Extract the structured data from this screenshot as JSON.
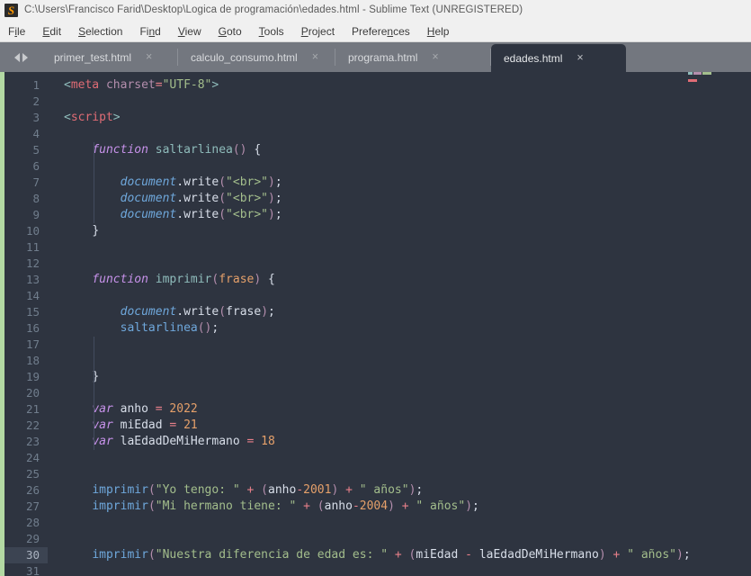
{
  "window": {
    "title": "C:\\Users\\Francisco Farid\\Desktop\\Logica de programación\\edades.html - Sublime Text (UNREGISTERED)",
    "logo_icon": "sublime-text-logo"
  },
  "menubar": {
    "items": [
      {
        "label": "File",
        "pre": "F",
        "key": "i",
        "post": "le"
      },
      {
        "label": "Edit",
        "pre": "",
        "key": "E",
        "post": "dit"
      },
      {
        "label": "Selection",
        "pre": "",
        "key": "S",
        "post": "election"
      },
      {
        "label": "Find",
        "pre": "Fi",
        "key": "n",
        "post": "d"
      },
      {
        "label": "View",
        "pre": "",
        "key": "V",
        "post": "iew"
      },
      {
        "label": "Goto",
        "pre": "",
        "key": "G",
        "post": "oto"
      },
      {
        "label": "Tools",
        "pre": "",
        "key": "T",
        "post": "ools"
      },
      {
        "label": "Project",
        "pre": "",
        "key": "P",
        "post": "roject"
      },
      {
        "label": "Preferences",
        "pre": "Prefere",
        "key": "n",
        "post": "ces"
      },
      {
        "label": "Help",
        "pre": "",
        "key": "H",
        "post": "elp"
      }
    ]
  },
  "tabbar": {
    "nav_prev_icon": "arrow-left-icon",
    "nav_next_icon": "arrow-right-icon",
    "close_glyph": "×",
    "tabs": [
      {
        "label": "primer_test.html",
        "active": false
      },
      {
        "label": "calculo_consumo.html",
        "active": false
      },
      {
        "label": "programa.html",
        "active": false
      },
      {
        "label": "edades.html",
        "active": true
      }
    ]
  },
  "editor": {
    "active_line": 30,
    "total_visible_lines": 31,
    "line_numbers": [
      1,
      2,
      3,
      4,
      5,
      6,
      7,
      8,
      9,
      10,
      11,
      12,
      13,
      14,
      15,
      16,
      17,
      18,
      19,
      20,
      21,
      22,
      23,
      24,
      25,
      26,
      27,
      28,
      29,
      30,
      31
    ],
    "lines": [
      {
        "n": 1,
        "text": "<meta charset=\"UTF-8\">"
      },
      {
        "n": 2,
        "text": ""
      },
      {
        "n": 3,
        "text": "<script>"
      },
      {
        "n": 4,
        "text": ""
      },
      {
        "n": 5,
        "text": "    function saltarlinea() {"
      },
      {
        "n": 6,
        "text": ""
      },
      {
        "n": 7,
        "text": "        document.write(\"<br>\");"
      },
      {
        "n": 8,
        "text": "        document.write(\"<br>\");"
      },
      {
        "n": 9,
        "text": "        document.write(\"<br>\");"
      },
      {
        "n": 10,
        "text": "    }"
      },
      {
        "n": 11,
        "text": ""
      },
      {
        "n": 12,
        "text": ""
      },
      {
        "n": 13,
        "text": "    function imprimir(frase) {"
      },
      {
        "n": 14,
        "text": ""
      },
      {
        "n": 15,
        "text": "        document.write(frase);"
      },
      {
        "n": 16,
        "text": "        saltarlinea();"
      },
      {
        "n": 17,
        "text": ""
      },
      {
        "n": 18,
        "text": ""
      },
      {
        "n": 19,
        "text": "    }"
      },
      {
        "n": 20,
        "text": ""
      },
      {
        "n": 21,
        "text": "    var anho = 2022"
      },
      {
        "n": 22,
        "text": "    var miEdad = 21"
      },
      {
        "n": 23,
        "text": "    var laEdadDeMiHermano = 18"
      },
      {
        "n": 24,
        "text": ""
      },
      {
        "n": 25,
        "text": ""
      },
      {
        "n": 26,
        "text": "    imprimir(\"Yo tengo: \" + (anho-2001) + \" años\");"
      },
      {
        "n": 27,
        "text": "    imprimir(\"Mi hermano tiene: \" + (anho-2004) + \" años\");"
      },
      {
        "n": 28,
        "text": ""
      },
      {
        "n": 29,
        "text": ""
      },
      {
        "n": 30,
        "text": "    imprimir(\"Nuestra diferencia de edad es: \" + (miEdad - laEdadDeMiHermano) + \" años\");"
      },
      {
        "n": 31,
        "text": ""
      }
    ]
  },
  "colors": {
    "titlebar_bg": "#f0f0f0",
    "menubar_bg": "#f0f0f0",
    "tabbar_bg": "#73777f",
    "editor_bg": "#2e3440",
    "active_tab_bg": "#2e3440",
    "modified_strip": "#b3d9a3",
    "gutter_text": "#707d8c",
    "active_line_bg": "#3c4452",
    "accent_orange": "#ff9800",
    "string_green": "#a3be8c",
    "keyword_purple": "#c792ea",
    "number_orange": "#e5a06a",
    "tag_red": "#e06c75",
    "function_teal": "#8fbcbb",
    "call_blue": "#6fa8dc"
  }
}
